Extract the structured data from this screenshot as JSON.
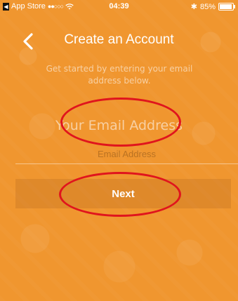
{
  "status_bar": {
    "back_app": "App Store",
    "signal": "●●○○○",
    "time": "04:39",
    "bluetooth": "✱",
    "battery": "85%"
  },
  "header": {
    "title": "Create an Account",
    "back_icon": "chevron-left-icon"
  },
  "form": {
    "subtitle": "Get started by entering your email address below.",
    "email_heading": "Your Email Address",
    "email_placeholder": "Email Address",
    "email_value": "",
    "next_label": "Next"
  },
  "colors": {
    "background": "#f0962f",
    "annotation": "#e0151d"
  }
}
